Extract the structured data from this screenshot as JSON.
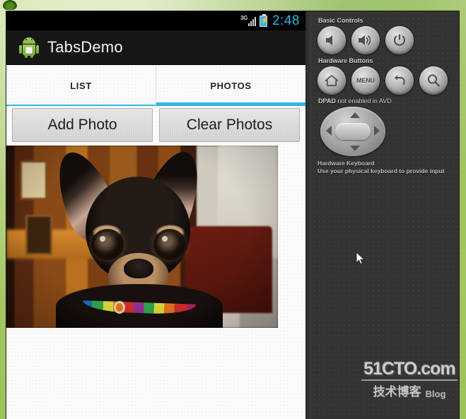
{
  "window": {
    "title": "TabsDemo"
  },
  "phone": {
    "status_bar": {
      "network": "3G",
      "clock": "2:48",
      "signal_icon": "signal-bars-icon",
      "battery_icon": "battery-charging-icon"
    },
    "action_bar": {
      "app_icon": "android-robot-icon",
      "title": "TabsDemo"
    },
    "tabs": [
      {
        "label": "LIST",
        "active": false
      },
      {
        "label": "PHOTOS",
        "active": true
      }
    ],
    "buttons": [
      {
        "label": "Add Photo"
      },
      {
        "label": "Clear Photos"
      }
    ],
    "photo": {
      "alt": "chihuahua-dog-photo"
    }
  },
  "control_panel": {
    "basic_controls_label": "Basic Controls",
    "basic_controls": [
      {
        "name": "volume-down-button",
        "icon": "speaker-icon"
      },
      {
        "name": "volume-up-button",
        "icon": "speaker-waves-icon"
      },
      {
        "name": "power-button",
        "icon": "power-icon"
      }
    ],
    "hardware_buttons_label": "Hardware Buttons",
    "hardware_buttons": [
      {
        "name": "home-button",
        "icon": "home-icon",
        "label": ""
      },
      {
        "name": "menu-button",
        "icon": "menu-text-icon",
        "label": "MENU"
      },
      {
        "name": "back-button",
        "icon": "back-arrow-icon",
        "label": ""
      },
      {
        "name": "search-button",
        "icon": "search-icon",
        "label": ""
      }
    ],
    "dpad_label_strong": "DPAD",
    "dpad_label_rest": " not enabled in AVD",
    "keyboard_label": "Hardware Keyboard",
    "keyboard_note": "Use your physical keyboard to provide input"
  },
  "watermark": {
    "top": "51CTO.com",
    "cn": "技术博客",
    "blog": "Blog"
  },
  "colors": {
    "accent_blue": "#33b5e5",
    "status_clock": "#34b3e0",
    "panel_bg": "#333333",
    "action_bar": "#161616"
  }
}
